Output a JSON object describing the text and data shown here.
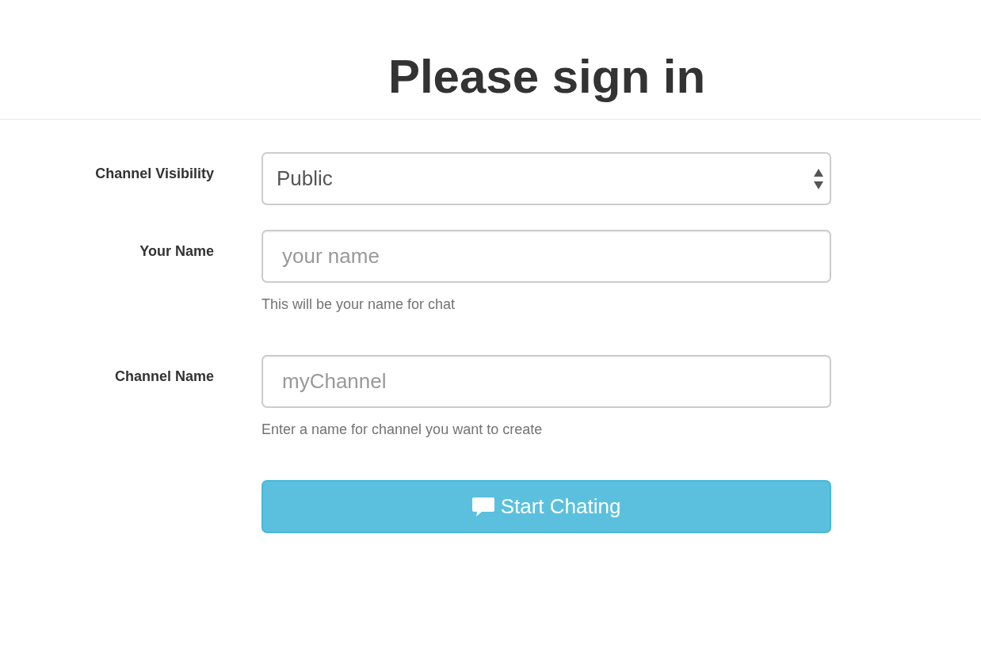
{
  "title": "Please sign in",
  "fields": [
    {
      "kind": "select",
      "label": "Channel Visibility",
      "value": "Public"
    },
    {
      "kind": "text",
      "label": "Your Name",
      "placeholder": "your name",
      "help": "This will be your name for chat"
    },
    {
      "kind": "text",
      "label": "Channel Name",
      "placeholder": "myChannel",
      "help": "Enter a name for channel you want to create"
    }
  ],
  "submit": {
    "label": "Start Chating"
  }
}
